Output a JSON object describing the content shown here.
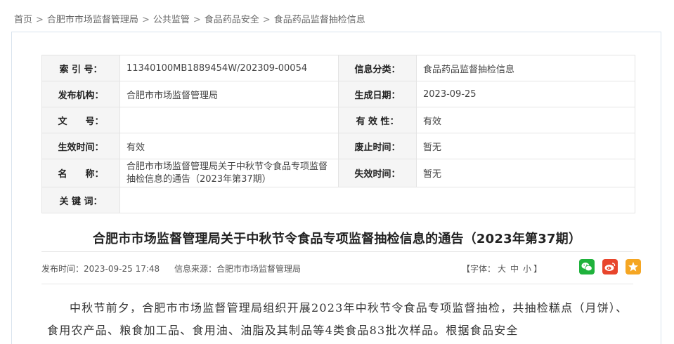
{
  "breadcrumb": {
    "items": [
      "首页",
      "合肥市市场监督管理局",
      "公共监管",
      "食品药品安全",
      "食品药品监督抽检信息"
    ],
    "separator": ">"
  },
  "meta": {
    "index_label": "索 引 号：",
    "index_value": "11340100MB1889454W/202309-00054",
    "category_label": "信息分类：",
    "category_value": "食品药品监督抽检信息",
    "publisher_label": "发布机构：",
    "publisher_value": "合肥市市场监督管理局",
    "gen_date_label": "生成日期：",
    "gen_date_value": "2023-09-25",
    "doc_no_label": "文　　号：",
    "doc_no_value": "",
    "validity_label": "有 效 性：",
    "validity_value": "有效",
    "effective_label": "生效时间：",
    "effective_value": "有效",
    "abolish_label": "废止时间：",
    "abolish_value": "暂无",
    "name_label": "名　　称：",
    "name_value": "合肥市市场监督管理局关于中秋节令食品专项监督抽检信息的通告（2023年第37期）",
    "expire_label": "失效时间：",
    "expire_value": "暂无",
    "keywords_label": "关 键 词：",
    "keywords_value": ""
  },
  "article": {
    "title": "合肥市市场监督管理局关于中秋节令食品专项监督抽检信息的通告（2023年第37期）",
    "date_label": "发布时间：",
    "date_value": "2023-09-25 17:48",
    "source_label": "信息来源：",
    "source_value": "合肥市市场监督管理局",
    "font_label": "【字体：",
    "font_large": "大",
    "font_medium": "中",
    "font_small": "小",
    "font_close": "】",
    "body": "中秋节前夕，合肥市市场监督管理局组织开展2023年中秋节令食品专项监督抽检，共抽检糕点（月饼）、食用农产品、粮食加工品、食用油、油脂及其制品等4类食品83批次样品。根据食品安全"
  },
  "share": {
    "icons": [
      "wechat-icon",
      "weibo-icon",
      "qzone-icon"
    ]
  },
  "colors": {
    "wechat": "#1fb23c",
    "weibo": "#e8452c",
    "qzone": "#f5a623",
    "label_bg": "#f5f5f5"
  }
}
